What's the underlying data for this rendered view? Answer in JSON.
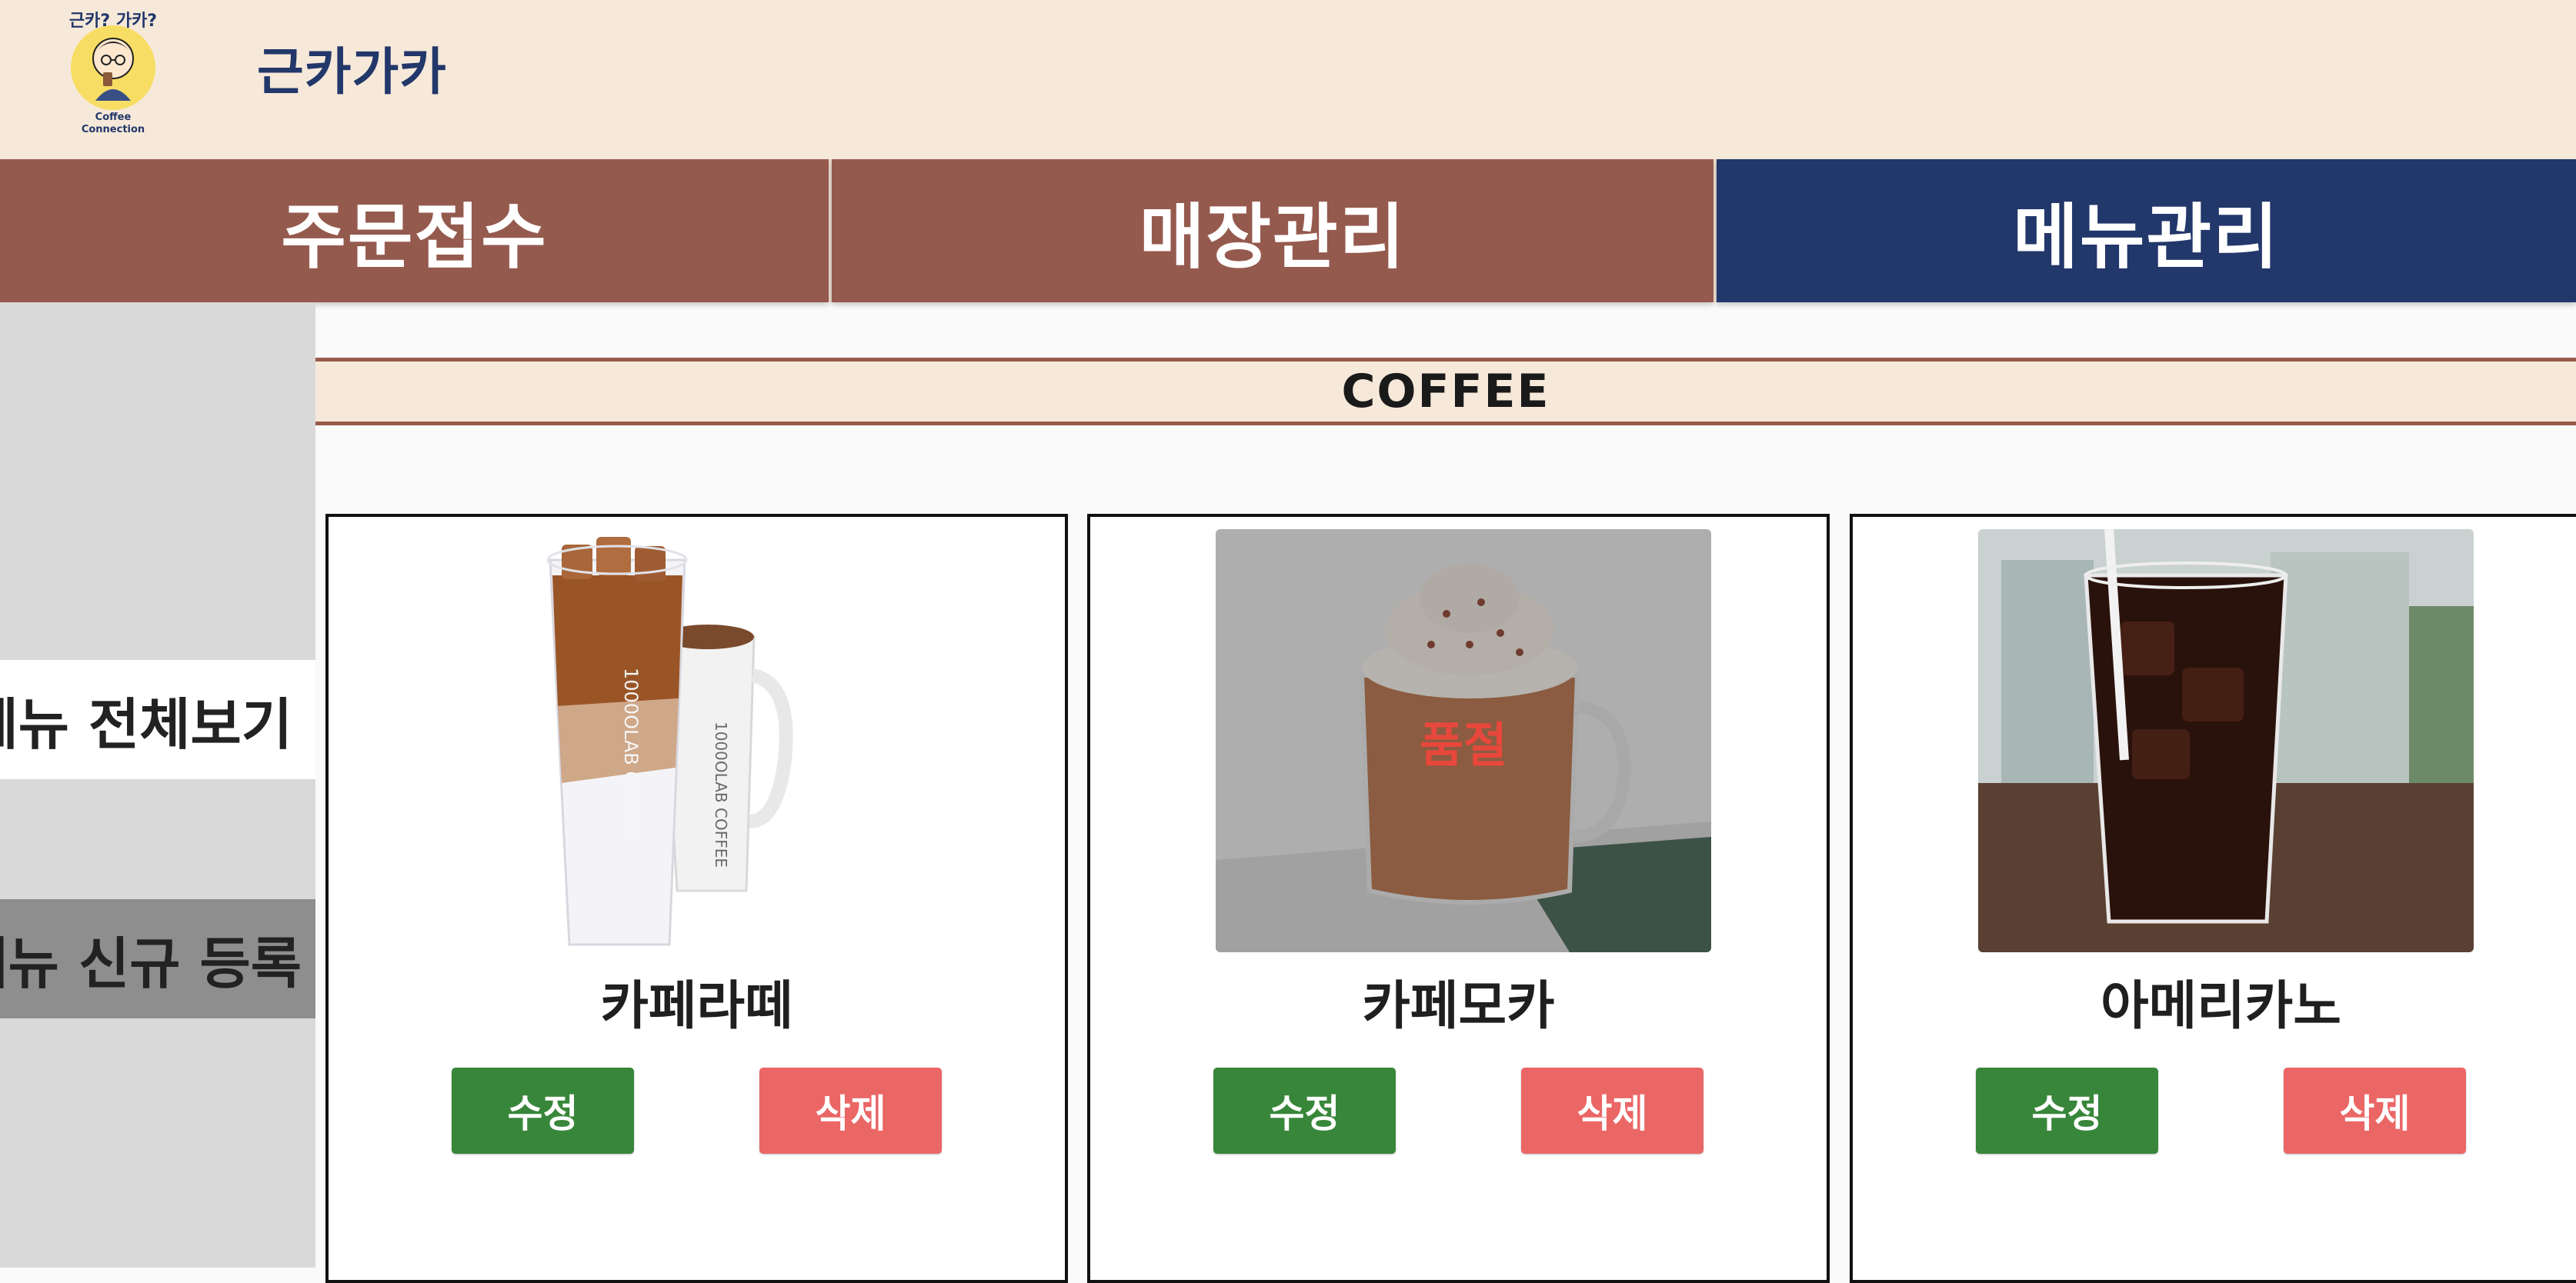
{
  "header": {
    "logo": {
      "arc_text": "근카? 가카?",
      "caption_line1": "Coffee",
      "caption_line2": "Connection"
    },
    "brand": "근카가카"
  },
  "nav": {
    "tabs": [
      {
        "label": "주문접수",
        "active": false
      },
      {
        "label": "매장관리",
        "active": false
      },
      {
        "label": "메뉴관리",
        "active": true
      }
    ]
  },
  "sidebar": {
    "view_all": "메뉴 전체보기",
    "register_new": "메뉴 신규 등록"
  },
  "category": {
    "title": "COFFEE"
  },
  "menu_items": [
    {
      "name": "카페라떼",
      "sold_out": false,
      "edit_label": "수정",
      "delete_label": "삭제",
      "cup_print": "1000OLAB COFFEE"
    },
    {
      "name": "카페모카",
      "sold_out": true,
      "sold_out_label": "품절",
      "edit_label": "수정",
      "delete_label": "삭제"
    },
    {
      "name": "아메리카노",
      "sold_out": false,
      "edit_label": "수정",
      "delete_label": "삭제"
    }
  ],
  "colors": {
    "header_bg": "#f6e9d9",
    "nav_inactive": "#955a4e",
    "nav_active": "#22376a",
    "edit_button": "#38863a",
    "delete_button": "#ea6766",
    "sold_out_text": "#e8473c"
  }
}
